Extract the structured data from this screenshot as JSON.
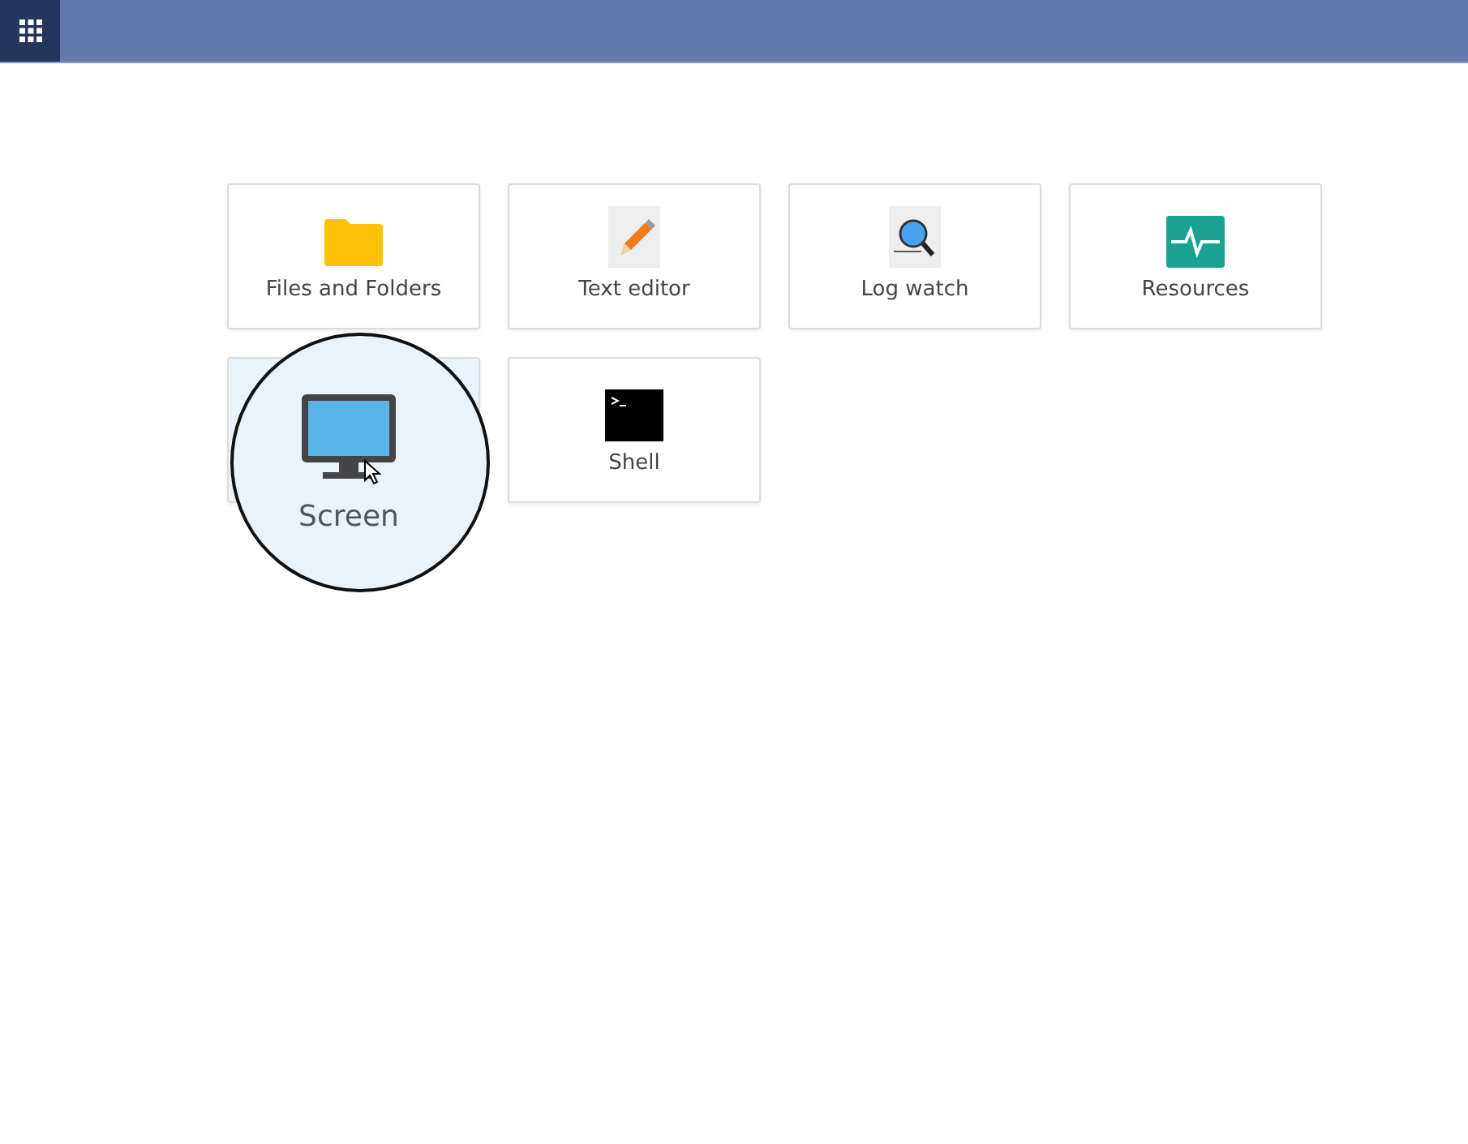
{
  "tiles": [
    {
      "label": "Files and Folders",
      "kind": "folder",
      "magnified": false
    },
    {
      "label": "Text editor",
      "kind": "editor",
      "magnified": false
    },
    {
      "label": "Log watch",
      "kind": "log",
      "magnified": false
    },
    {
      "label": "Resources",
      "kind": "resources",
      "magnified": false
    },
    {
      "label": "Screen",
      "kind": "screen",
      "magnified": true
    },
    {
      "label": "Shell",
      "kind": "shell",
      "magnified": false
    }
  ]
}
